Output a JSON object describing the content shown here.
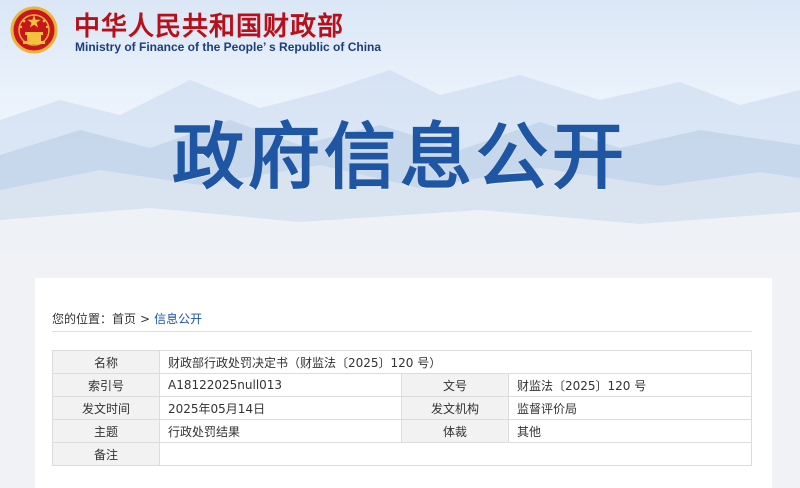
{
  "header": {
    "emblem_icon": "national-emblem-icon",
    "title_cn": "中华人民共和国财政部",
    "title_en": "Ministry of Finance of the People’ s Republic of China",
    "title_color": "#b8101a",
    "title_en_color": "#1d3e78"
  },
  "banner": {
    "heading": "政府信息公开",
    "heading_color": "#1f56a3"
  },
  "breadcrumb": {
    "prefix": "您的位置：",
    "items": [
      "首页",
      "信息公开"
    ],
    "separator": ">"
  },
  "info_table": {
    "name_label": "名称",
    "name_value": "财政部行政处罚决定书（财监法〔2025〕120 号）",
    "index_label": "索引号",
    "index_value": "A18122025null013",
    "docno_label": "文号",
    "docno_value": "财监法〔2025〕120 号",
    "date_label": "发文时间",
    "date_value": "2025年05月14日",
    "issuer_label": "发文机构",
    "issuer_value": "监督评价局",
    "topic_label": "主题",
    "topic_value": "行政处罚结果",
    "genre_label": "体裁",
    "genre_value": "其他",
    "remark_label": "备注",
    "remark_value": ""
  }
}
